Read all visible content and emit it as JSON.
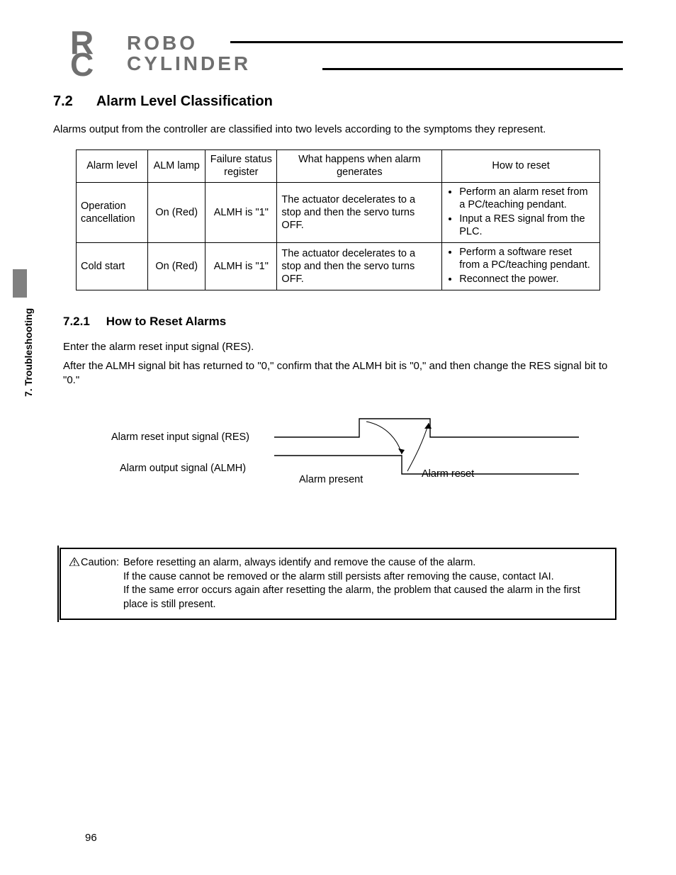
{
  "logo": {
    "line1": "ROBO",
    "line2": "CYLINDER",
    "rc_r": "R",
    "rc_c": "C"
  },
  "side_tab": "7. Troubleshooting",
  "section": {
    "num": "7.2",
    "title": "Alarm Level Classification"
  },
  "intro": "Alarms output from the controller are classified into two levels according to the symptoms they represent.",
  "table": {
    "headers": {
      "level": "Alarm level",
      "lamp": "ALM lamp",
      "reg": "Failure status register",
      "what": "What happens when alarm generates",
      "reset": "How to reset"
    },
    "rows": [
      {
        "level": "Operation cancellation",
        "lamp": "On (Red)",
        "reg": "ALMH is \"1\"",
        "what": "The actuator decelerates to a stop and then the servo turns OFF.",
        "reset": [
          "Perform an alarm reset from a PC/teaching pendant.",
          "Input a RES signal from the PLC."
        ]
      },
      {
        "level": "Cold start",
        "lamp": "On (Red)",
        "reg": "ALMH is \"1\"",
        "what": "The actuator decelerates to a stop and then the servo turns OFF.",
        "reset": [
          "Perform a software reset from a PC/teaching pendant.",
          "Reconnect the power."
        ]
      }
    ]
  },
  "subsection": {
    "num": "7.2.1",
    "title": "How to Reset Alarms"
  },
  "body1": "Enter the alarm reset input signal (RES).",
  "body2": "After the ALMH signal bit has returned to \"0,\" confirm that the ALMH bit is \"0,\" and then change the RES signal bit to \"0.\"",
  "timing": {
    "label1": "Alarm reset input signal (RES)",
    "label2": "Alarm output signal (ALMH)",
    "present": "Alarm present",
    "reset": "Alarm reset"
  },
  "caution": {
    "label": "Caution:",
    "lines": [
      "Before resetting an alarm, always identify and remove the cause of the alarm.",
      "If the cause cannot be removed or the alarm still persists after removing the cause, contact IAI.",
      "If the same error occurs again after resetting the alarm, the problem that caused the alarm in the first place is still present."
    ]
  },
  "page_number": "96"
}
